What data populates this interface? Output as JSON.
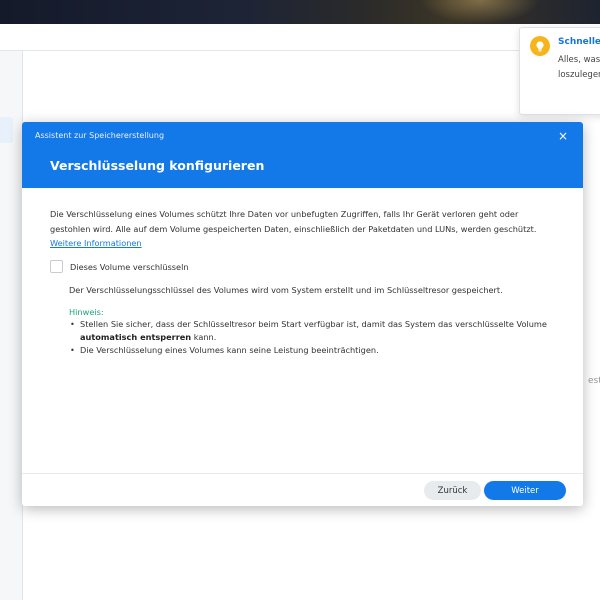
{
  "notification": {
    "title": "Schnelle",
    "body": "Alles, was loszulegen",
    "icon": "lightbulb-icon",
    "accent": "#f6b51d"
  },
  "background": {
    "peek_text": "este"
  },
  "dialog": {
    "caption": "Assistent zur Speichererstellung",
    "title": "Verschlüsselung konfigurieren",
    "close_label": "×",
    "intro_text": "Die Verschlüsselung eines Volumes schützt Ihre Daten vor unbefugten Zugriffen, falls Ihr Gerät verloren geht oder gestohlen wird. Alle auf dem Volume gespeicherten Daten, einschließlich der Paketdaten und LUNs, werden geschützt.",
    "more_info_link": "Weitere Informationen",
    "checkbox_label": "Dieses Volume verschlüsseln",
    "checkbox_checked": false,
    "key_info": "Der Verschlüsselungsschlüssel des Volumes wird vom System erstellt und im Schlüsseltresor gespeichert.",
    "hint_title": "Hinweis:",
    "hint_1_before": "Stellen Sie sicher, dass der Schlüsseltresor beim Start verfügbar ist, damit das System das verschlüsselte Volume",
    "hint_1_bold": "automatisch entsperren",
    "hint_1_after": "kann.",
    "hint_2": "Die Verschlüsselung eines Volumes kann seine Leistung beeinträchtigen.",
    "back_button": "Zurück",
    "next_button": "Weiter",
    "header_color": "#1479e8"
  }
}
